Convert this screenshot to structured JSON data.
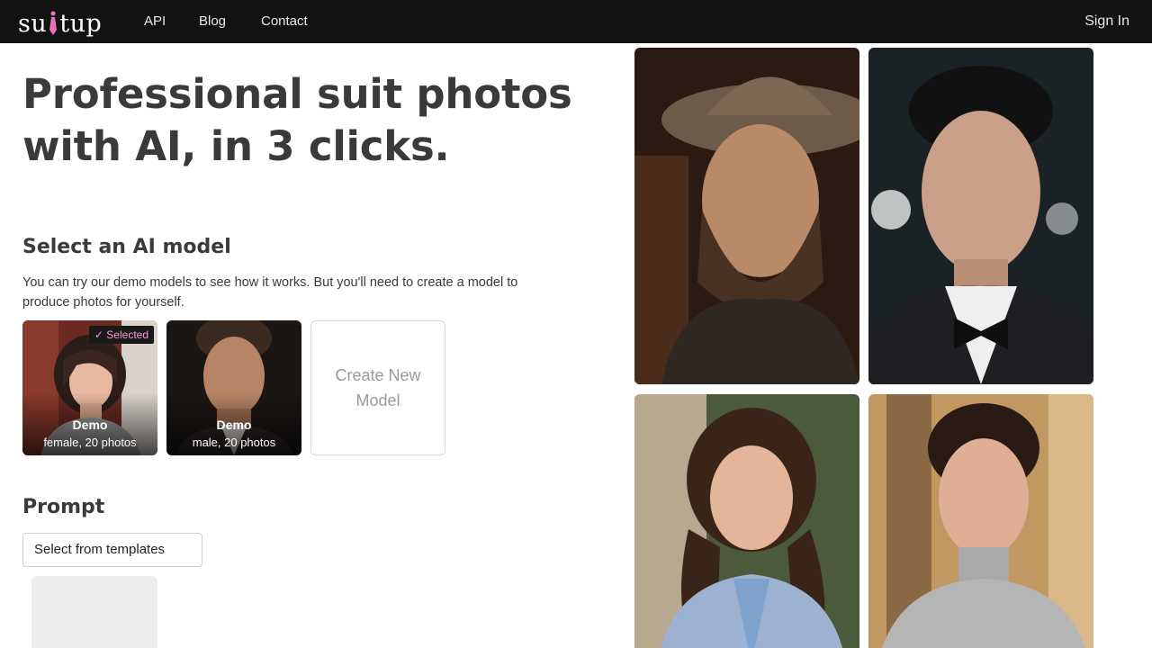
{
  "nav": {
    "logo": "suitup",
    "links": [
      "API",
      "Blog",
      "Contact"
    ],
    "sign_in": "Sign In"
  },
  "hero": {
    "headline": "Professional suit photos with AI, in 3 clicks."
  },
  "model_section": {
    "title": "Select an AI model",
    "description": "You can try our demo models to see how it works. But you'll need to create a model to produce photos for yourself.",
    "models": [
      {
        "name": "Demo",
        "meta": "female, 20 photos",
        "selected_badge": "✓ Selected"
      },
      {
        "name": "Demo",
        "meta": "male, 20 photos"
      }
    ],
    "create_new": "Create New Model"
  },
  "prompt_section": {
    "title": "Prompt",
    "template_select": "Select from templates"
  },
  "colors": {
    "navbar": "#121212",
    "badge_text": "#ff9ad4",
    "heading": "#3a3a3a"
  }
}
